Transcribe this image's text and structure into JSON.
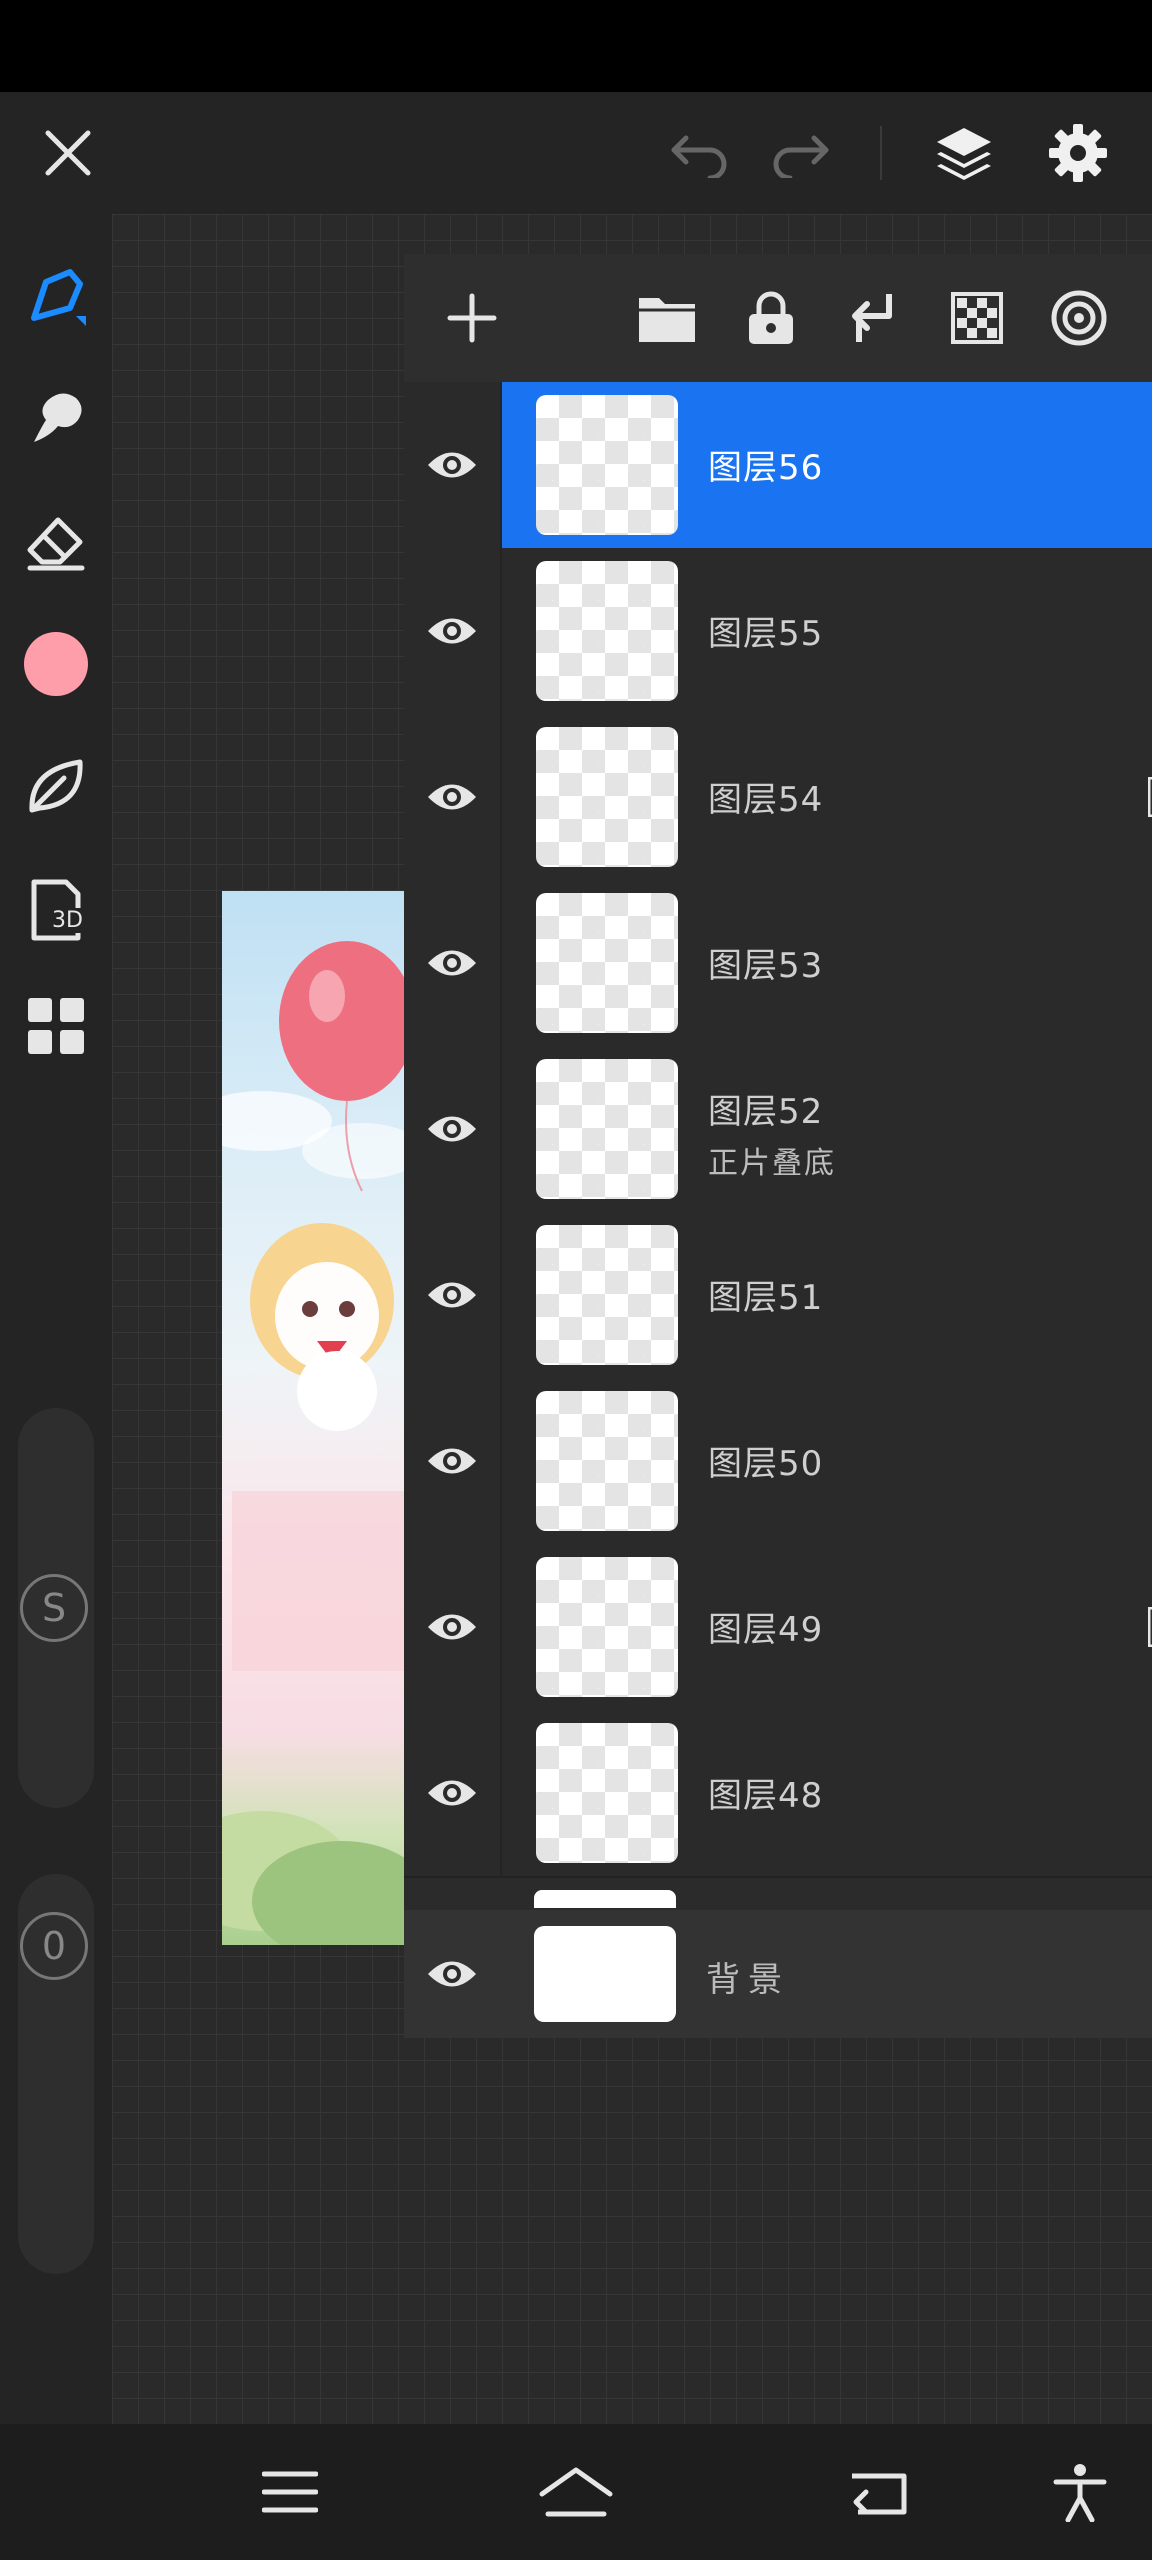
{
  "colors": {
    "accent": "#1a73f0",
    "current_color": "#ff9eab",
    "panel": "#2b2b2b",
    "toolbar": "#242424"
  },
  "topbar": {
    "icons": [
      "close-icon",
      "undo-icon",
      "redo-icon",
      "layers-icon",
      "gear-icon"
    ]
  },
  "left_toolbar": {
    "tools": [
      "pen-icon",
      "smudge-icon",
      "eraser-icon",
      "color-swatch",
      "leaf-icon",
      "3d-icon",
      "grid-icon"
    ],
    "badge_3d": "3D",
    "size_slider_label": "S",
    "opacity_slider_label": "0"
  },
  "layers_panel": {
    "toolbar_icons": [
      "add-layer-icon",
      "folder-icon",
      "lock-icon",
      "merge-down-icon",
      "transparency-icon",
      "blend-icon"
    ],
    "layers": [
      {
        "name": "图层56",
        "selected": true,
        "alpha_lock": false
      },
      {
        "name": "图层55",
        "selected": false,
        "alpha_lock": false
      },
      {
        "name": "图层54",
        "selected": false,
        "alpha_lock": true
      },
      {
        "name": "图层53",
        "selected": false,
        "alpha_lock": false
      },
      {
        "name": "图层52",
        "sub": "正片叠底",
        "selected": false,
        "alpha_lock": false
      },
      {
        "name": "图层51",
        "selected": false,
        "alpha_lock": false
      },
      {
        "name": "图层50",
        "selected": false,
        "alpha_lock": false
      },
      {
        "name": "图层49",
        "selected": false,
        "alpha_lock": true
      },
      {
        "name": "图层48",
        "selected": false,
        "alpha_lock": false
      }
    ],
    "background_layer": {
      "name": "背景"
    }
  },
  "bottom_nav": {
    "icons": [
      "menu-icon",
      "home-icon",
      "back-icon",
      "accessibility-icon"
    ]
  }
}
